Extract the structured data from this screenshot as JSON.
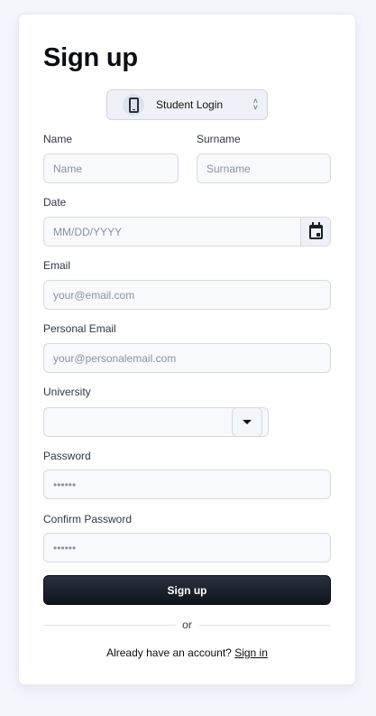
{
  "form": {
    "title": "Sign up",
    "login_type": {
      "selected": "Student Login",
      "icon": "phone-icon"
    },
    "fields": {
      "name": {
        "label": "Name",
        "placeholder": "Name"
      },
      "surname": {
        "label": "Surname",
        "placeholder": "Surname"
      },
      "date": {
        "label": "Date",
        "placeholder": "MM/DD/YYYY",
        "icon": "calendar-icon"
      },
      "email": {
        "label": "Email",
        "placeholder": "your@email.com"
      },
      "personal_email": {
        "label": "Personal Email",
        "placeholder": "your@personalemail.com"
      },
      "university": {
        "label": "University",
        "value": "",
        "icon": "caret-down-icon"
      },
      "password": {
        "label": "Password",
        "placeholder": "••••••"
      },
      "confirm_password": {
        "label": "Confirm Password",
        "placeholder": "••••••"
      }
    },
    "submit_label": "Sign up",
    "divider_text": "or",
    "footer": {
      "text": "Already have an account?",
      "link": "Sign in"
    }
  },
  "colors": {
    "page_background": "#f3f6fb",
    "card_background": "#ffffff",
    "input_background": "#f7f9fc",
    "button_background": "#0f131b",
    "text_primary": "#0b0d12",
    "text_label": "#2f3848"
  }
}
